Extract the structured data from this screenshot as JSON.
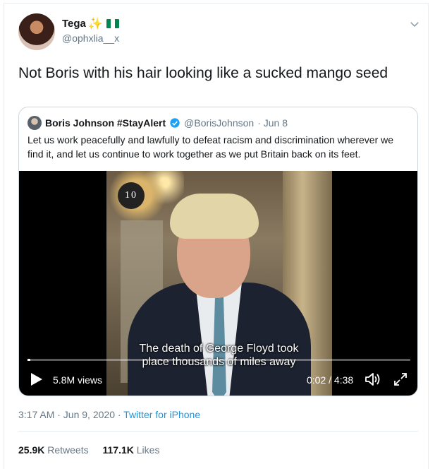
{
  "tweet": {
    "author_name": "Tega",
    "author_emoji_name": "sparkles-icon",
    "author_flag_name": "nigeria-flag-icon",
    "author_flag_colors": [
      "#008751",
      "#ffffff",
      "#008751"
    ],
    "handle": "@ophxlia__x",
    "text": "Not Boris with his hair looking like a sucked mango seed",
    "timestamp": "3:17 AM · Jun 9, 2020 · ",
    "source": "Twitter for iPhone",
    "retweets_count": "25.9K",
    "retweets_label": "Retweets",
    "likes_count": "117.1K",
    "likes_label": "Likes"
  },
  "quoted": {
    "name": "Boris Johnson #StayAlert",
    "handle": "@BorisJohnson",
    "date": "· Jun 8",
    "text": "Let us work peacefully and lawfully to defeat racism and discrimination wherever we find it, and let us continue to work together as we put Britain back on its feet.",
    "video": {
      "channel_badge": "10",
      "subtitle_line1": "The death of George Floyd took",
      "subtitle_line2": "place thousands of miles away",
      "views": "5.8M views",
      "time": "0:02 / 4:38",
      "progress_fraction": 0.007
    }
  },
  "colors": {
    "link_blue": "#1b95e0",
    "verified_blue": "#1da1f2",
    "secondary_text": "#657786"
  }
}
